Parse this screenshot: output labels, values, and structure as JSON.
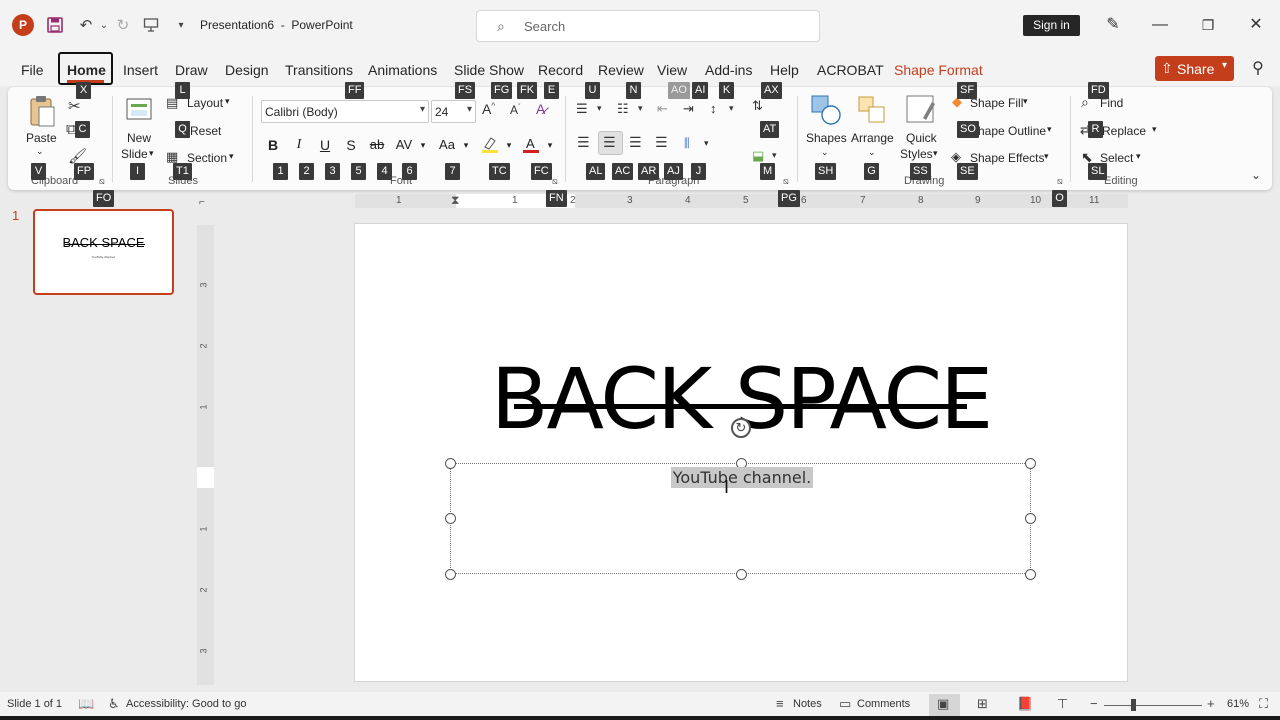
{
  "title_bar": {
    "app_logo": "P",
    "doc_title": "Presentation6  -  PowerPoint",
    "search_placeholder": "Search",
    "sign_in": "Sign in",
    "icons": [
      "save-icon",
      "undo-icon",
      "redo-icon",
      "present-icon",
      "customize-icon"
    ]
  },
  "menu": {
    "tabs": [
      "File",
      "Home",
      "Insert",
      "Draw",
      "Design",
      "Transitions",
      "Animations",
      "Slide Show",
      "Record",
      "Review",
      "View",
      "Add-ins",
      "Help",
      "ACROBAT",
      "Shape Format"
    ],
    "active_tab": "Home",
    "share": "Share"
  },
  "ribbon": {
    "clipboard": {
      "paste": "Paste",
      "label": "Clipboard"
    },
    "slides": {
      "new_slide_1": "New",
      "new_slide_2": "Slide",
      "layout": "Layout",
      "reset": "Reset",
      "section": "Section",
      "label": "Slides"
    },
    "font": {
      "font_name": "Calibri (Body)",
      "font_size": "24",
      "bold": "B",
      "italic": "I",
      "underline": "U",
      "shadow": "S",
      "strike": "ab",
      "spacing": "AV",
      "case": "Aa",
      "label": "Font"
    },
    "paragraph": {
      "label": "Paragraph"
    },
    "drawing": {
      "shapes": "Shapes",
      "arrange": "Arrange",
      "quick_styles_1": "Quick",
      "quick_styles_2": "Styles",
      "shape_fill": "Shape Fill",
      "shape_outline": "Shape Outline",
      "shape_effects": "Shape Effects",
      "label": "Drawing"
    },
    "editing": {
      "find": "Find",
      "replace": "Replace",
      "select": "Select",
      "label": "Editing"
    }
  },
  "keytips": {
    "x": "X",
    "l": "L",
    "ff": "FF",
    "fs": "FS",
    "fg": "FG",
    "fk": "FK",
    "e": "E",
    "u": "U",
    "n": "N",
    "ao": "AO",
    "ai": "AI",
    "k": "K",
    "ax": "AX",
    "sf": "SF",
    "fd": "FD",
    "c": "C",
    "q": "Q",
    "at": "AT",
    "so": "SO",
    "r": "R",
    "k1": "1",
    "k2": "2",
    "k3": "3",
    "k5": "5",
    "k4": "4",
    "k6": "6",
    "k7": "7",
    "tc": "TC",
    "fc": "FC",
    "al": "AL",
    "ac": "AC",
    "ar": "AR",
    "aj": "AJ",
    "j": "J",
    "m": "M",
    "sh": "SH",
    "g": "G",
    "ss": "SS",
    "se": "SE",
    "sl": "SL",
    "v": "V",
    "fp": "FP",
    "i": "I",
    "t1": "T1",
    "fo": "FO",
    "fn": "FN",
    "pg": "PG",
    "o": "O"
  },
  "slides_panel": {
    "slide_number": "1",
    "thumb_title": "BACK SPACE",
    "thumb_sub": "YouTube channel."
  },
  "slide": {
    "title": "BACK SPACE",
    "subtitle": "YouTube channel."
  },
  "ruler": {
    "h_numbers": [
      "1",
      "1",
      "2",
      "3",
      "4",
      "5",
      "6",
      "7",
      "8",
      "9",
      "10",
      "11"
    ],
    "v_numbers": [
      "3",
      "2",
      "1",
      "1",
      "2",
      "3"
    ]
  },
  "status": {
    "slide_of": "Slide 1 of 1",
    "accessibility": "Accessibility: Good to go",
    "notes": "Notes",
    "comments": "Comments",
    "zoom": "61%"
  },
  "colors": {
    "accent": "#c43e1c",
    "keytip": "#3a3a3a"
  }
}
